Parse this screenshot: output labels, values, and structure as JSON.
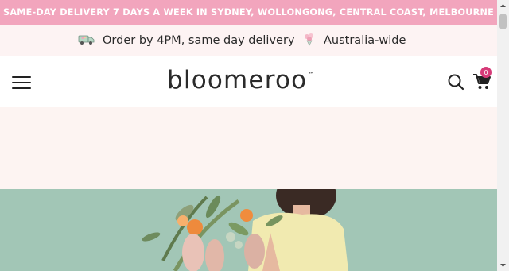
{
  "promo": {
    "text": "SAME-DAY DELIVERY 7 DAYS A WEEK IN SYDNEY, WOLLONGONG, CENTRAL COAST, MELBOURNE"
  },
  "usp": [
    {
      "icon": "delivery-van-icon",
      "text": "Order by 4PM, same day delivery"
    },
    {
      "icon": "flower-bouquet-icon",
      "text": "Australia-wide"
    }
  ],
  "header": {
    "menu_icon": "hamburger-menu-icon",
    "logo": "bloomeroo",
    "logo_tm": "™",
    "search_icon": "search-icon",
    "cart_icon": "cart-icon",
    "cart_count": "0"
  },
  "colors": {
    "promo_bg": "#f2a5bd",
    "usp_bg": "#fdf3f3",
    "banner_bg": "#fdf4f2",
    "hero_bg": "#a2c6b6",
    "badge": "#d63b78"
  }
}
